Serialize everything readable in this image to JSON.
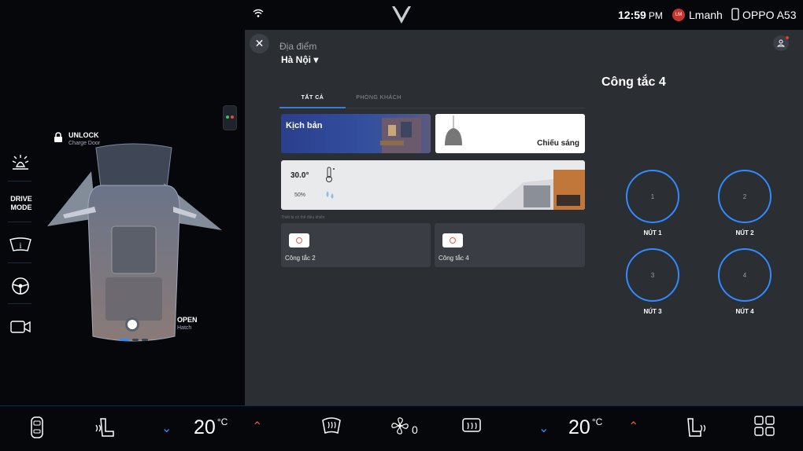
{
  "status_bar": {
    "time": "12:59",
    "ampm": "PM",
    "user_initials": "LM",
    "user_name": "Lmanh",
    "phone_name": "OPPO A53"
  },
  "left_panel": {
    "drive_mode_label": "DRIVE\nMODE",
    "unlock_title": "UNLOCK",
    "unlock_sub": "Charge Door",
    "open_title": "OPEN",
    "open_sub": "Hatch"
  },
  "main": {
    "location_label": "Địa điểm",
    "location_value": "Hà Nội",
    "tabs": [
      {
        "label": "TẤT CẢ"
      },
      {
        "label": "PHÒNG KHÁCH"
      }
    ],
    "cards": {
      "scenario": "Kịch bản",
      "lighting": "Chiếu sáng",
      "temperature": "30.0°",
      "humidity": "50%",
      "devices_caption": "Thiết bị có thể điều khiển",
      "switch_a": "Công tắc 2",
      "switch_b": "Công tắc 4"
    }
  },
  "detail": {
    "title": "Công tắc 4",
    "buttons": [
      {
        "num": "1",
        "label": "NÚT 1"
      },
      {
        "num": "2",
        "label": "NÚT 2"
      },
      {
        "num": "3",
        "label": "NÚT 3"
      },
      {
        "num": "4",
        "label": "NÚT 4"
      }
    ]
  },
  "climate": {
    "left_temp": "20",
    "right_temp": "20",
    "unit": "°C",
    "fan_speed": "0"
  },
  "colors": {
    "accent": "#2f8cff",
    "down_arrow": "#2f8cff",
    "up_arrow": "#e8533f"
  }
}
